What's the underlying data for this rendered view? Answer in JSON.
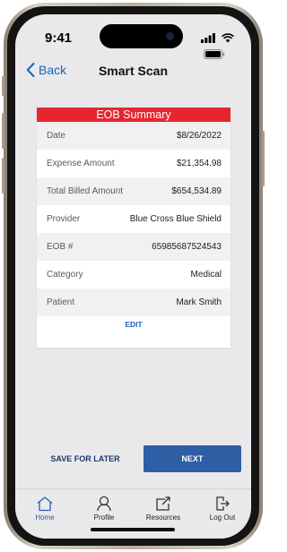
{
  "status_bar": {
    "time": "9:41"
  },
  "nav": {
    "back_label": "Back",
    "title": "Smart Scan"
  },
  "summary": {
    "header": "EOB Summary",
    "rows": [
      {
        "label": "Date",
        "value": "$8/26/2022"
      },
      {
        "label": "Expense Amount",
        "value": "$21,354.98"
      },
      {
        "label": "Total Billed Amount",
        "value": "$654,534.89"
      },
      {
        "label": "Provider",
        "value": "Blue Cross Blue Shield"
      },
      {
        "label": "EOB #",
        "value": "65985687524543"
      },
      {
        "label": "Category",
        "value": "Medical"
      },
      {
        "label": "Patient",
        "value": "Mark Smith"
      }
    ],
    "edit_label": "EDIT"
  },
  "actions": {
    "save_later_label": "SAVE FOR LATER",
    "next_label": "NEXT"
  },
  "tabs": [
    {
      "label": "Home",
      "icon": "home-icon",
      "active": true
    },
    {
      "label": "Profile",
      "icon": "person-icon",
      "active": false
    },
    {
      "label": "Resources",
      "icon": "external-link-icon",
      "active": false
    },
    {
      "label": "Log Out",
      "icon": "logout-icon",
      "active": false
    }
  ],
  "colors": {
    "accent_red": "#e5262f",
    "primary_blue": "#2e5ea4",
    "link_blue": "#1e63b8",
    "screen_bg": "#e9e9eb"
  }
}
